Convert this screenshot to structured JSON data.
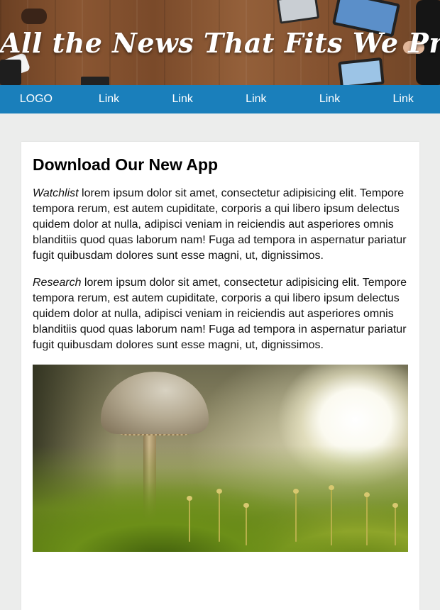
{
  "hero": {
    "title": "All the News That Fits We Print!"
  },
  "nav": {
    "logo": "LOGO",
    "links": [
      "Link",
      "Link",
      "Link",
      "Link",
      "Link"
    ]
  },
  "article": {
    "heading": "Download Our New App",
    "paragraphs": [
      {
        "emphasis": "Watchlist",
        "text": " lorem ipsum dolor sit amet, consectetur adipisicing elit. Tempore tempora rerum, est autem cupiditate, corporis a qui libero ipsum delectus quidem dolor at nulla, adipisci veniam in reiciendis aut asperiores omnis blanditiis quod quas laborum nam! Fuga ad tempora in aspernatur pariatur fugit quibusdam dolores sunt esse magni, ut, dignissimos."
      },
      {
        "emphasis": "Research",
        "text": " lorem ipsum dolor sit amet, consectetur adipisicing elit. Tempore tempora rerum, est autem cupiditate, corporis a qui libero ipsum delectus quidem dolor at nulla, adipisci veniam in reiciendis aut asperiores omnis blanditiis quod quas laborum nam! Fuga ad tempora in aspernatur pariatur fugit quibusdam dolores sunt esse magni, ut, dignissimos."
      }
    ]
  },
  "colors": {
    "nav_background": "#1a7fbb",
    "page_background": "#ecedec"
  }
}
